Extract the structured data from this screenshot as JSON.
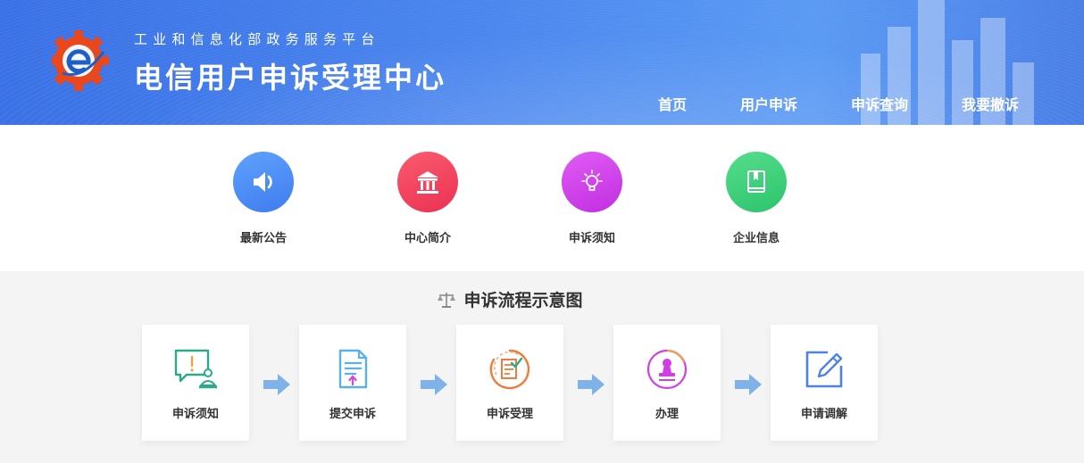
{
  "header": {
    "subtitle": "工业和信息化部政务服务平台",
    "title": "电信用户申诉受理中心",
    "logo_icon": "gear-e-logo-icon",
    "nav": [
      {
        "label": "首页"
      },
      {
        "label": "用户申诉"
      },
      {
        "label": "申诉查询"
      },
      {
        "label": "我要撤诉"
      }
    ]
  },
  "quick_links": [
    {
      "label": "最新公告",
      "icon": "speaker-icon",
      "color": "#4e8df5"
    },
    {
      "label": "中心简介",
      "icon": "building-icon",
      "color": "#f2435f"
    },
    {
      "label": "申诉须知",
      "icon": "lightbulb-icon",
      "color": "#d23ee6"
    },
    {
      "label": "企业信息",
      "icon": "book-icon",
      "color": "#3fd07e"
    }
  ],
  "process": {
    "title": "申诉流程示意图",
    "title_icon": "scale-icon",
    "steps": [
      {
        "label": "申诉须知",
        "icon": "notice-chat-icon"
      },
      {
        "label": "提交申诉",
        "icon": "upload-document-icon"
      },
      {
        "label": "申诉受理",
        "icon": "accept-document-icon"
      },
      {
        "label": "办理",
        "icon": "stamp-icon"
      },
      {
        "label": "申请调解",
        "icon": "edit-pen-icon"
      }
    ],
    "arrow_icon": "right-arrow-icon"
  }
}
